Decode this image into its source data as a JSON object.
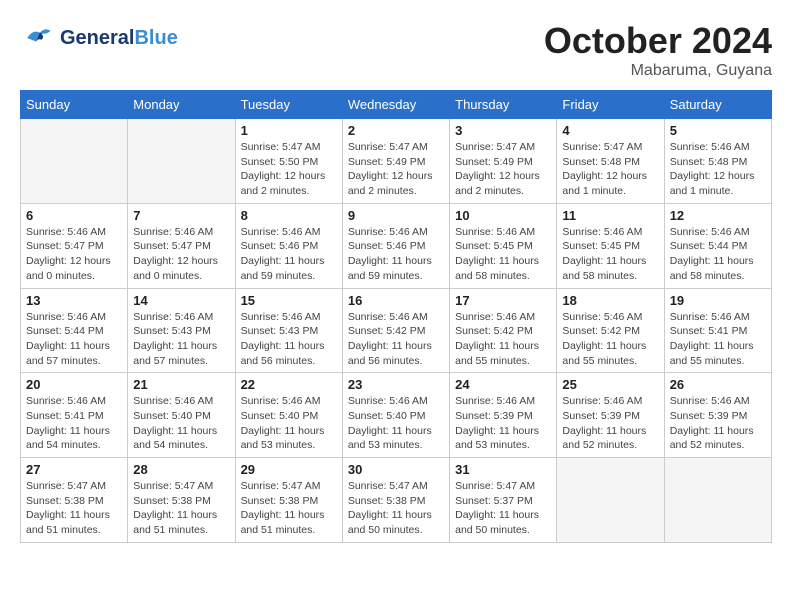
{
  "header": {
    "logo_general": "General",
    "logo_blue": "Blue",
    "month": "October 2024",
    "location": "Mabaruma, Guyana"
  },
  "days_of_week": [
    "Sunday",
    "Monday",
    "Tuesday",
    "Wednesday",
    "Thursday",
    "Friday",
    "Saturday"
  ],
  "weeks": [
    [
      {
        "day": "",
        "info": ""
      },
      {
        "day": "",
        "info": ""
      },
      {
        "day": "1",
        "info": "Sunrise: 5:47 AM\nSunset: 5:50 PM\nDaylight: 12 hours and 2 minutes."
      },
      {
        "day": "2",
        "info": "Sunrise: 5:47 AM\nSunset: 5:49 PM\nDaylight: 12 hours and 2 minutes."
      },
      {
        "day": "3",
        "info": "Sunrise: 5:47 AM\nSunset: 5:49 PM\nDaylight: 12 hours and 2 minutes."
      },
      {
        "day": "4",
        "info": "Sunrise: 5:47 AM\nSunset: 5:48 PM\nDaylight: 12 hours and 1 minute."
      },
      {
        "day": "5",
        "info": "Sunrise: 5:46 AM\nSunset: 5:48 PM\nDaylight: 12 hours and 1 minute."
      }
    ],
    [
      {
        "day": "6",
        "info": "Sunrise: 5:46 AM\nSunset: 5:47 PM\nDaylight: 12 hours and 0 minutes."
      },
      {
        "day": "7",
        "info": "Sunrise: 5:46 AM\nSunset: 5:47 PM\nDaylight: 12 hours and 0 minutes."
      },
      {
        "day": "8",
        "info": "Sunrise: 5:46 AM\nSunset: 5:46 PM\nDaylight: 11 hours and 59 minutes."
      },
      {
        "day": "9",
        "info": "Sunrise: 5:46 AM\nSunset: 5:46 PM\nDaylight: 11 hours and 59 minutes."
      },
      {
        "day": "10",
        "info": "Sunrise: 5:46 AM\nSunset: 5:45 PM\nDaylight: 11 hours and 58 minutes."
      },
      {
        "day": "11",
        "info": "Sunrise: 5:46 AM\nSunset: 5:45 PM\nDaylight: 11 hours and 58 minutes."
      },
      {
        "day": "12",
        "info": "Sunrise: 5:46 AM\nSunset: 5:44 PM\nDaylight: 11 hours and 58 minutes."
      }
    ],
    [
      {
        "day": "13",
        "info": "Sunrise: 5:46 AM\nSunset: 5:44 PM\nDaylight: 11 hours and 57 minutes."
      },
      {
        "day": "14",
        "info": "Sunrise: 5:46 AM\nSunset: 5:43 PM\nDaylight: 11 hours and 57 minutes."
      },
      {
        "day": "15",
        "info": "Sunrise: 5:46 AM\nSunset: 5:43 PM\nDaylight: 11 hours and 56 minutes."
      },
      {
        "day": "16",
        "info": "Sunrise: 5:46 AM\nSunset: 5:42 PM\nDaylight: 11 hours and 56 minutes."
      },
      {
        "day": "17",
        "info": "Sunrise: 5:46 AM\nSunset: 5:42 PM\nDaylight: 11 hours and 55 minutes."
      },
      {
        "day": "18",
        "info": "Sunrise: 5:46 AM\nSunset: 5:42 PM\nDaylight: 11 hours and 55 minutes."
      },
      {
        "day": "19",
        "info": "Sunrise: 5:46 AM\nSunset: 5:41 PM\nDaylight: 11 hours and 55 minutes."
      }
    ],
    [
      {
        "day": "20",
        "info": "Sunrise: 5:46 AM\nSunset: 5:41 PM\nDaylight: 11 hours and 54 minutes."
      },
      {
        "day": "21",
        "info": "Sunrise: 5:46 AM\nSunset: 5:40 PM\nDaylight: 11 hours and 54 minutes."
      },
      {
        "day": "22",
        "info": "Sunrise: 5:46 AM\nSunset: 5:40 PM\nDaylight: 11 hours and 53 minutes."
      },
      {
        "day": "23",
        "info": "Sunrise: 5:46 AM\nSunset: 5:40 PM\nDaylight: 11 hours and 53 minutes."
      },
      {
        "day": "24",
        "info": "Sunrise: 5:46 AM\nSunset: 5:39 PM\nDaylight: 11 hours and 53 minutes."
      },
      {
        "day": "25",
        "info": "Sunrise: 5:46 AM\nSunset: 5:39 PM\nDaylight: 11 hours and 52 minutes."
      },
      {
        "day": "26",
        "info": "Sunrise: 5:46 AM\nSunset: 5:39 PM\nDaylight: 11 hours and 52 minutes."
      }
    ],
    [
      {
        "day": "27",
        "info": "Sunrise: 5:47 AM\nSunset: 5:38 PM\nDaylight: 11 hours and 51 minutes."
      },
      {
        "day": "28",
        "info": "Sunrise: 5:47 AM\nSunset: 5:38 PM\nDaylight: 11 hours and 51 minutes."
      },
      {
        "day": "29",
        "info": "Sunrise: 5:47 AM\nSunset: 5:38 PM\nDaylight: 11 hours and 51 minutes."
      },
      {
        "day": "30",
        "info": "Sunrise: 5:47 AM\nSunset: 5:38 PM\nDaylight: 11 hours and 50 minutes."
      },
      {
        "day": "31",
        "info": "Sunrise: 5:47 AM\nSunset: 5:37 PM\nDaylight: 11 hours and 50 minutes."
      },
      {
        "day": "",
        "info": ""
      },
      {
        "day": "",
        "info": ""
      }
    ]
  ]
}
